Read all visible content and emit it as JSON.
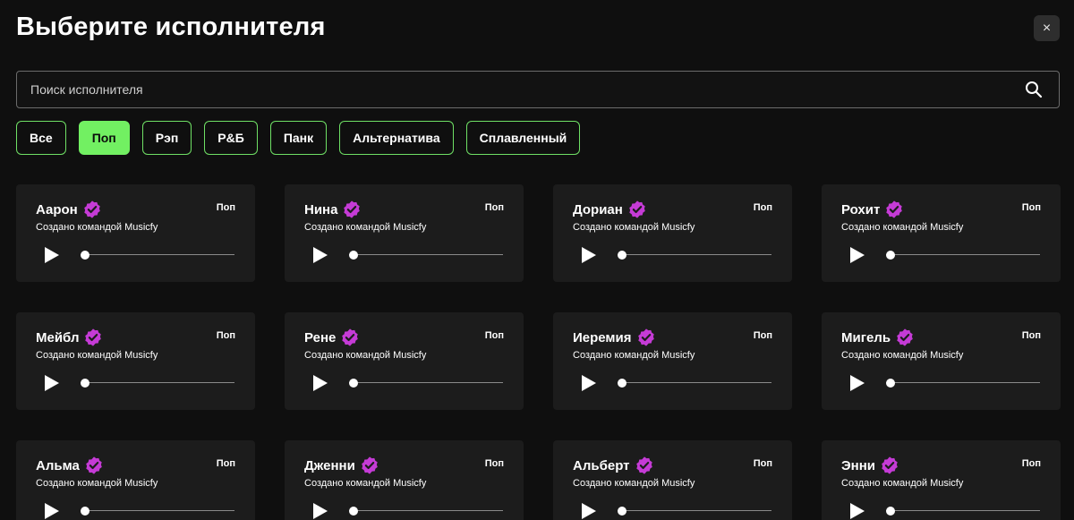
{
  "header": {
    "title": "Выберите исполнителя",
    "close_label": "×"
  },
  "search": {
    "placeholder": "Поиск исполнителя",
    "value": ""
  },
  "filters": [
    {
      "label": "Все",
      "active": false
    },
    {
      "label": "Поп",
      "active": true
    },
    {
      "label": "Рэп",
      "active": false
    },
    {
      "label": "Р&Б",
      "active": false
    },
    {
      "label": "Панк",
      "active": false
    },
    {
      "label": "Альтернатива",
      "active": false
    },
    {
      "label": "Сплавленный",
      "active": false
    }
  ],
  "artists": [
    {
      "name": "Аарон",
      "genre": "Поп",
      "subtitle": "Создано командой Musicfy",
      "progress": 0
    },
    {
      "name": "Нина",
      "genre": "Поп",
      "subtitle": "Создано командой Musicfy",
      "progress": 0
    },
    {
      "name": "Дориан",
      "genre": "Поп",
      "subtitle": "Создано командой Musicfy",
      "progress": 0
    },
    {
      "name": "Рохит",
      "genre": "Поп",
      "subtitle": "Создано командой Musicfy",
      "progress": 0
    },
    {
      "name": "Мейбл",
      "genre": "Поп",
      "subtitle": "Создано командой Musicfy",
      "progress": 0
    },
    {
      "name": "Рене",
      "genre": "Поп",
      "subtitle": "Создано командой Musicfy",
      "progress": 0
    },
    {
      "name": "Иеремия",
      "genre": "Поп",
      "subtitle": "Создано командой Musicfy",
      "progress": 0
    },
    {
      "name": "Мигель",
      "genre": "Поп",
      "subtitle": "Создано командой Musicfy",
      "progress": 0
    },
    {
      "name": "Альма",
      "genre": "Поп",
      "subtitle": "Создано командой Musicfy",
      "progress": 0
    },
    {
      "name": "Дженни",
      "genre": "Поп",
      "subtitle": "Создано командой Musicfy",
      "progress": 0
    },
    {
      "name": "Альберт",
      "genre": "Поп",
      "subtitle": "Создано командой Musicfy",
      "progress": 0
    },
    {
      "name": "Энни",
      "genre": "Поп",
      "subtitle": "Создано командой Musicfy",
      "progress": 0
    }
  ],
  "icons": {
    "close": "close-icon",
    "search": "search-icon",
    "verified": "verified-badge-icon",
    "play": "play-icon"
  },
  "colors": {
    "background": "#0f0f0f",
    "card": "#1c1c1c",
    "accent_green": "#72f062",
    "verified_purple": "#c53bd6"
  }
}
